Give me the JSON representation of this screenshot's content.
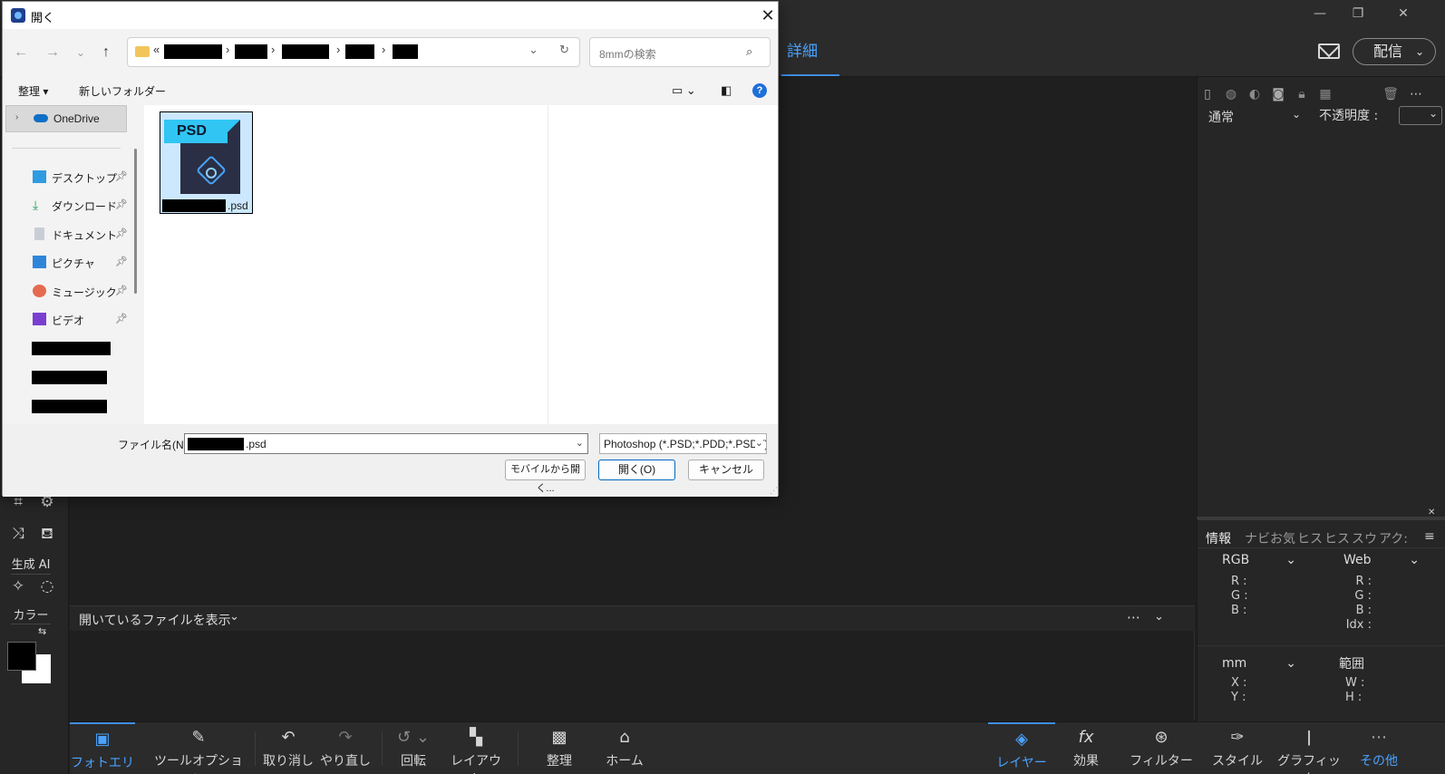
{
  "app": {
    "header_tab": "詳細",
    "share_label": "配信",
    "generative_ai_label": "生成 AI",
    "color_label": "カラー",
    "blend_mode": "通常",
    "opacity_label": "不透明度 :"
  },
  "info_panel": {
    "tabs": [
      "情報",
      "ナビ",
      "お気",
      "ヒス",
      "ヒス",
      "スウ",
      "アク:"
    ],
    "left_mode": "RGB",
    "right_mode": "Web",
    "rgb_left": [
      "R :",
      "G :",
      "B :"
    ],
    "rgb_right": [
      "R :",
      "G :",
      "B :",
      "Idx :"
    ],
    "unit": "mm",
    "range_label": "範囲",
    "xy": [
      "X :",
      "Y :"
    ],
    "wh": [
      "W :",
      "H :"
    ]
  },
  "bin": {
    "show_open_files": "開いているファイルを表示"
  },
  "bottom_bar": {
    "left": [
      {
        "label": "フォトエリア",
        "icon": "photo-bin-icon",
        "active": true
      },
      {
        "label": "ツールオプション",
        "icon": "tool-options-icon"
      },
      {
        "label": "取り消し",
        "icon": "undo-icon"
      },
      {
        "label": "やり直し",
        "icon": "redo-icon"
      },
      {
        "label": "回転",
        "icon": "rotate-icon"
      },
      {
        "label": "レイアウト",
        "icon": "layout-icon"
      },
      {
        "label": "整理",
        "icon": "organizer-icon"
      },
      {
        "label": "ホーム",
        "icon": "home-icon"
      }
    ],
    "right": [
      {
        "label": "レイヤー",
        "icon": "layers-icon",
        "active": true
      },
      {
        "label": "効果",
        "icon": "fx-icon"
      },
      {
        "label": "フィルター",
        "icon": "filter-icon"
      },
      {
        "label": "スタイル",
        "icon": "styles-icon"
      },
      {
        "label": "グラフィック",
        "icon": "graphics-icon"
      },
      {
        "label": "その他",
        "icon": "more-icon",
        "active_text": true
      }
    ]
  },
  "dialog": {
    "title": "開く",
    "search_placeholder": "8mmの検索",
    "organize_label": "整理 ▾",
    "new_folder_label": "新しいフォルダー",
    "nav": {
      "onedrive": "OneDrive",
      "items": [
        {
          "label": "デスクトップ",
          "icon": "desktop-icon"
        },
        {
          "label": "ダウンロード",
          "icon": "download-icon"
        },
        {
          "label": "ドキュメント",
          "icon": "documents-icon"
        },
        {
          "label": "ピクチャ",
          "icon": "pictures-icon"
        },
        {
          "label": "ミュージック",
          "icon": "music-icon"
        },
        {
          "label": "ビデオ",
          "icon": "videos-icon"
        }
      ]
    },
    "file": {
      "badge": "PSD",
      "ext": ".psd"
    },
    "filename_label": "ファイル名(N):",
    "filename_ext": ".psd",
    "filetype": "Photoshop (*.PSD;*.PDD;*.PSDT)",
    "buttons": {
      "mobile_open": "モバイルから開く...",
      "open": "開く(O)",
      "cancel": "キャンセル"
    }
  }
}
